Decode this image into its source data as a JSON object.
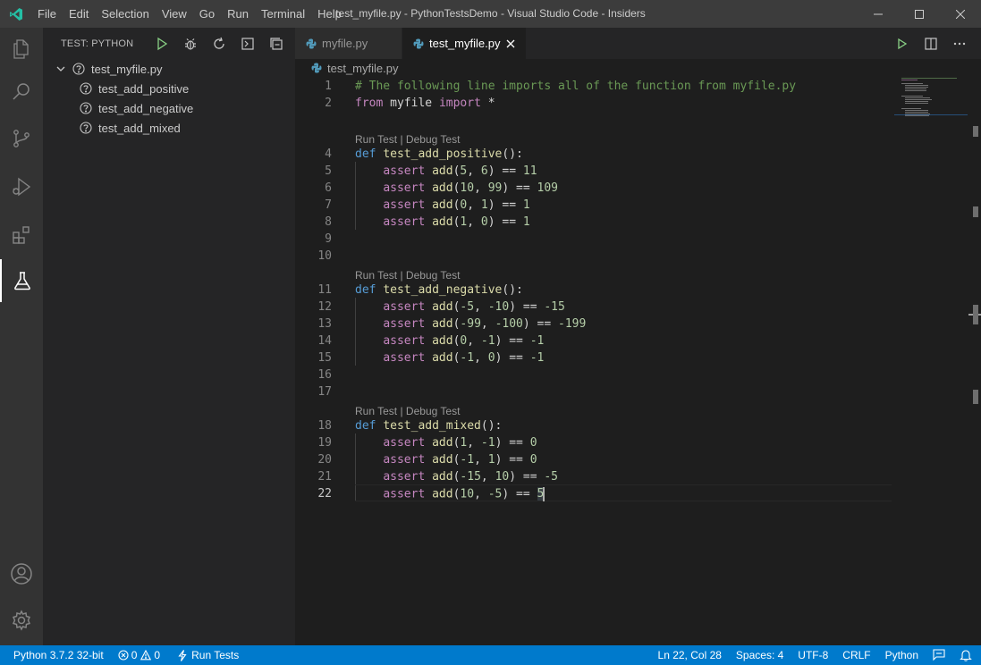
{
  "window": {
    "title": "test_myfile.py - PythonTestsDemo - Visual Studio Code - Insiders",
    "menu": [
      "File",
      "Edit",
      "Selection",
      "View",
      "Go",
      "Run",
      "Terminal",
      "Help"
    ]
  },
  "activity_bar": {
    "items": [
      "explorer-icon",
      "search-icon",
      "source-control-icon",
      "run-debug-icon",
      "extensions-icon",
      "test-flask-icon"
    ],
    "bottom": [
      "account-icon",
      "settings-gear-icon"
    ],
    "active": "test-flask-icon"
  },
  "sidebar": {
    "title": "TEST: PYTHON",
    "actions": [
      "run-all-tests-icon",
      "debug-all-tests-icon",
      "refresh-tests-icon",
      "show-output-icon",
      "collapse-all-icon"
    ],
    "tree": {
      "file": "test_myfile.py",
      "tests": [
        "test_add_positive",
        "test_add_negative",
        "test_add_mixed"
      ]
    }
  },
  "tabs": [
    {
      "label": "myfile.py",
      "active": false
    },
    {
      "label": "test_myfile.py",
      "active": true
    }
  ],
  "breadcrumb": "test_myfile.py",
  "codelens": "Run Test | Debug Test",
  "code": {
    "l1": "# The following line imports all of the function from myfile.py",
    "l2_kw1": "from",
    "l2_mod": "myfile",
    "l2_kw2": "import",
    "l2_star": "*",
    "def": "def",
    "assert": "assert",
    "call": "add",
    "f4": "test_add_positive",
    "f11": "test_add_negative",
    "f18": "test_add_mixed",
    "l5": [
      "5",
      "6",
      "11"
    ],
    "l6": [
      "10",
      "99",
      "109"
    ],
    "l7": [
      "0",
      "1",
      "1"
    ],
    "l8": [
      "1",
      "0",
      "1"
    ],
    "l12": [
      "-5",
      "-10",
      "-15"
    ],
    "l13": [
      "-99",
      "-100",
      "-199"
    ],
    "l14": [
      "0",
      "-1",
      "-1"
    ],
    "l15": [
      "-1",
      "0",
      "-1"
    ],
    "l19": [
      "1",
      "-1",
      "0"
    ],
    "l20": [
      "-1",
      "1",
      "0"
    ],
    "l21": [
      "-15",
      "10",
      "-5"
    ],
    "l22": [
      "10",
      "-5",
      "5"
    ]
  },
  "line_numbers": [
    "1",
    "2",
    "4",
    "5",
    "6",
    "7",
    "8",
    "9",
    "10",
    "11",
    "12",
    "13",
    "14",
    "15",
    "16",
    "17",
    "18",
    "19",
    "20",
    "21",
    "22"
  ],
  "statusbar": {
    "python": "Python 3.7.2 32-bit",
    "errors": "0",
    "warnings": "0",
    "run_tests": "Run Tests",
    "position": "Ln 22, Col 28",
    "spaces": "Spaces: 4",
    "encoding": "UTF-8",
    "eol": "CRLF",
    "language": "Python"
  },
  "colors": {
    "statusbar": "#007acc",
    "activitybar": "#333333",
    "sidebar": "#252526",
    "editor": "#1e1e1e",
    "run_green": "#89d185"
  }
}
